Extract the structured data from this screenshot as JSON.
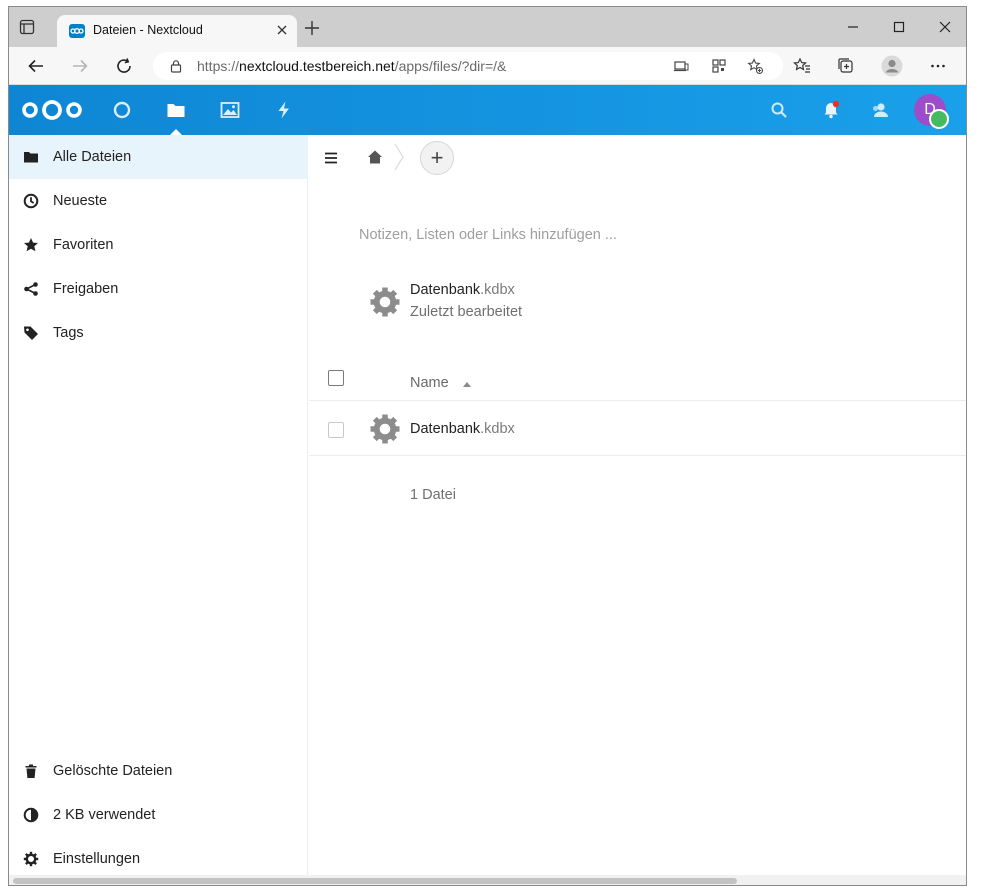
{
  "browser": {
    "tab_title": "Dateien - Nextcloud",
    "url_prefix": "https://",
    "url_host": "nextcloud.testbereich.net",
    "url_path": "/apps/files/?dir=/&"
  },
  "header": {
    "apps": [
      {
        "name": "dashboard",
        "icon": "circle-icon"
      },
      {
        "name": "files",
        "icon": "folder-icon",
        "active": true
      },
      {
        "name": "photos",
        "icon": "image-icon"
      },
      {
        "name": "activity",
        "icon": "lightning-icon"
      }
    ],
    "avatar_initial": "D",
    "brand_color": "#0082c9",
    "status_color": "#46ba61"
  },
  "sidebar": {
    "items": [
      {
        "label": "Alle Dateien",
        "icon": "folder-icon"
      },
      {
        "label": "Neueste",
        "icon": "clock-icon"
      },
      {
        "label": "Favoriten",
        "icon": "star-icon"
      },
      {
        "label": "Freigaben",
        "icon": "share-icon"
      },
      {
        "label": "Tags",
        "icon": "tag-icon"
      }
    ],
    "bottom_items": [
      {
        "label": "Gelöschte Dateien",
        "icon": "trash-icon"
      },
      {
        "label": "2 KB verwendet",
        "icon": "pie-chart-icon"
      },
      {
        "label": "Einstellungen",
        "icon": "gear-icon"
      }
    ]
  },
  "content": {
    "notes_placeholder": "Notizen, Listen oder Links hinzufügen ...",
    "recent": {
      "name": "Datenbank",
      "ext": ".kdbx",
      "subtitle": "Zuletzt bearbeitet"
    },
    "list": {
      "column_name": "Name",
      "rows": [
        {
          "name": "Datenbank",
          "ext": ".kdbx"
        }
      ],
      "summary": "1 Datei"
    }
  }
}
